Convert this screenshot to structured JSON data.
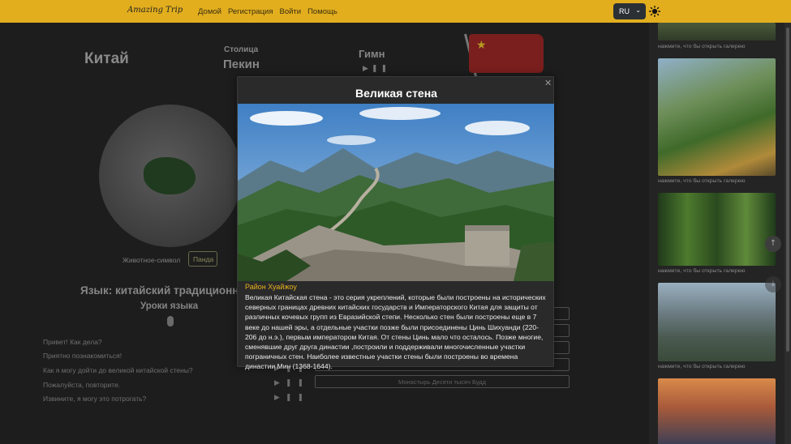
{
  "header": {
    "brand": "Amazing Trip",
    "nav": [
      "Домой",
      "Регистрация",
      "Войти",
      "Помощь"
    ],
    "language_select": "RU"
  },
  "country": {
    "name": "Китай",
    "capital_label": "Столица",
    "capital": "Пекин",
    "anthem_label": "Гимн",
    "animal_label": "Животное-символ",
    "animal_button": "Панда",
    "language_title": "Язык: китайский традиционный",
    "lessons_title": "Уроки языка"
  },
  "phrases": [
    "Привет! Как дела?",
    "Приятно познакомиться!",
    "Как я могу дойти до великой китайской стены?",
    "Пожалуйста, повторите.",
    "Извините, я могу это потрогать?"
  ],
  "sights": [
    "",
    "",
    "",
    "",
    "Монастырь Десяти тысяч Будд"
  ],
  "gallery": {
    "caption": "нажмите, что бы открыть галерею"
  },
  "modal": {
    "title": "Великая стена",
    "location": "Район Хуайжоу",
    "text": "Великая Китайская стена - это серия укреплений, которые были построены на исторических северных границах древних китайских государств и Императорского Китая для защиты от различных кочевых групп из Евразийской степи. Несколько стен были построены еще в 7 веке до нашей эры, а отдельные участки позже были присоединены Цинь Шихуанди (220-206 до н.э.), первым императором Китая. От стены Цинь мало что осталось. Позже многие, сменявшие друг друга династии ,построили и поддерживали многочисленные участки пограничных стен. Наиболее известные участки стены были построены во времена династии Мин (1368-1644)."
  },
  "colors": {
    "header_bg": "#e2ae1e",
    "accent": "#e3b21c",
    "page_bg": "#1b1b1b"
  }
}
